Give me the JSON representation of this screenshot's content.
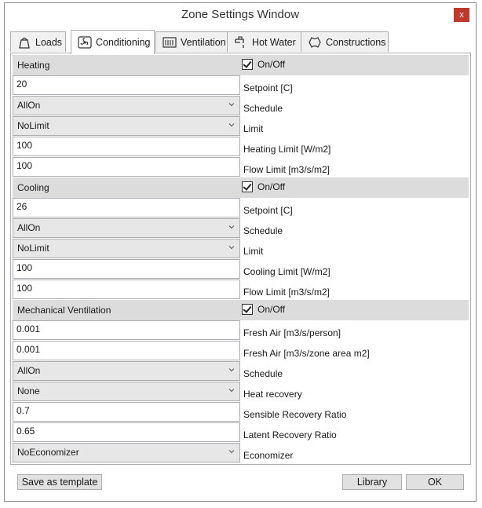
{
  "window": {
    "title": "Zone Settings Window",
    "close_label": "x"
  },
  "tabs": [
    {
      "label": "Loads",
      "icon": "weight-icon"
    },
    {
      "label": "Conditioning",
      "icon": "fan-icon"
    },
    {
      "label": "Ventilation",
      "icon": "vent-icon"
    },
    {
      "label": "Hot Water",
      "icon": "faucet-icon"
    },
    {
      "label": "Constructions",
      "icon": "construction-icon"
    }
  ],
  "active_tab": "Conditioning",
  "heating": {
    "title": "Heating",
    "onoff_label": "On/Off",
    "enabled": true,
    "setpoint": "20",
    "setpoint_label": "Setpoint [C]",
    "schedule": "AllOn",
    "schedule_label": "Schedule",
    "limit": "NoLimit",
    "limit_label": "Limit",
    "heating_limit": "100",
    "heating_limit_label": "Heating Limit [W/m2]",
    "flow_limit": "100",
    "flow_limit_label": "Flow Limit [m3/s/m2]"
  },
  "cooling": {
    "title": "Cooling",
    "onoff_label": "On/Off",
    "enabled": true,
    "setpoint": "26",
    "setpoint_label": "Setpoint [C]",
    "schedule": "AllOn",
    "schedule_label": "Schedule",
    "limit": "NoLimit",
    "limit_label": "Limit",
    "cooling_limit": "100",
    "cooling_limit_label": "Cooling Limit [W/m2]",
    "flow_limit": "100",
    "flow_limit_label": "Flow Limit [m3/s/m2]"
  },
  "mechvent": {
    "title": "Mechanical Ventilation",
    "onoff_label": "On/Off",
    "enabled": true,
    "fresh_air_person": "0.001",
    "fresh_air_person_label": "Fresh Air [m3/s/person]",
    "fresh_air_area": "0.001",
    "fresh_air_area_label": "Fresh Air [m3/s/zone area m2]",
    "schedule": "AllOn",
    "schedule_label": "Schedule",
    "heat_recovery": "None",
    "heat_recovery_label": "Heat recovery",
    "sensible_ratio": "0.7",
    "sensible_ratio_label": "Sensible Recovery Ratio",
    "latent_ratio": "0.65",
    "latent_ratio_label": "Latent Recovery Ratio",
    "economizer": "NoEconomizer",
    "economizer_label": "Economizer"
  },
  "footer": {
    "save_template": "Save as template",
    "library": "Library",
    "ok": "OK"
  }
}
